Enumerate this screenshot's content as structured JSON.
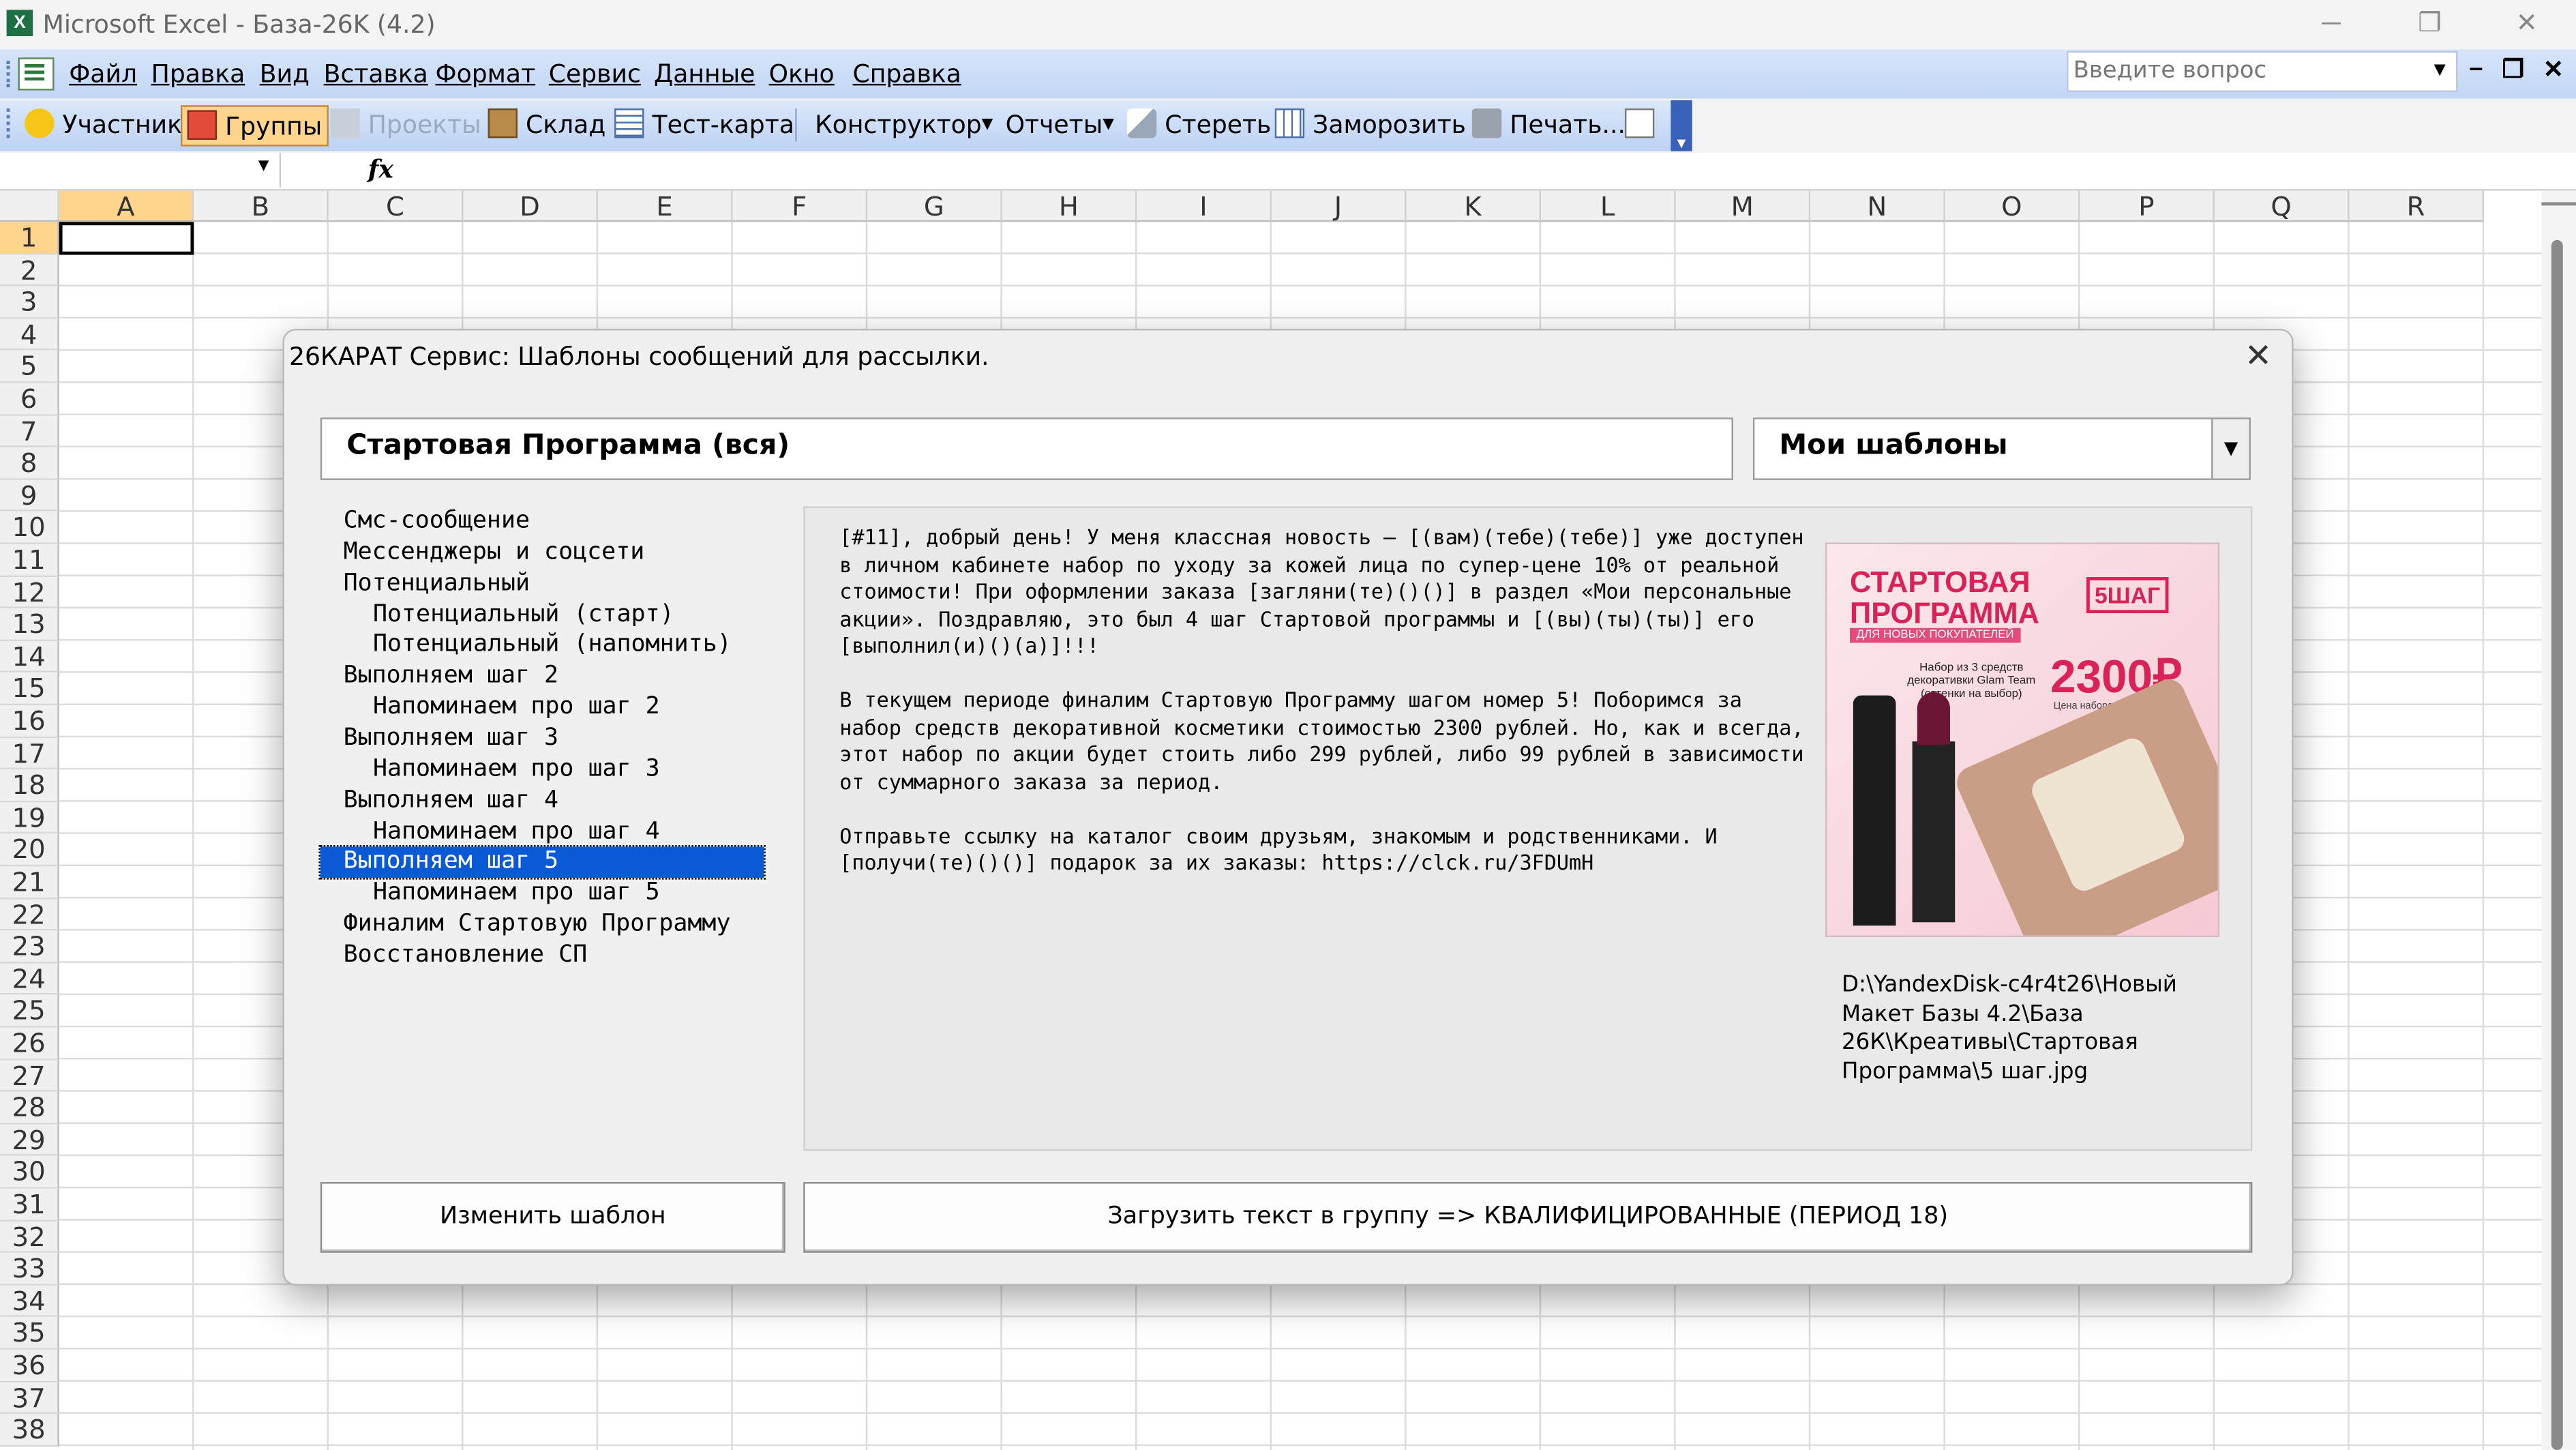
{
  "window": {
    "title": "Microsoft Excel - База-26K (4.2)",
    "app_icon": "excel-icon",
    "controls": [
      "minimize-icon",
      "restore-icon",
      "close-icon"
    ]
  },
  "menubar": {
    "items": [
      "Файл",
      "Правка",
      "Вид",
      "Вставка",
      "Формат",
      "Сервис",
      "Данные",
      "Окно",
      "Справка"
    ],
    "ask_placeholder": "Введите вопрос"
  },
  "toolbar": {
    "buttons": [
      {
        "label": "Участник",
        "icon": "smiley-icon",
        "state": "normal"
      },
      {
        "label": "Группы",
        "icon": "groups-icon",
        "state": "active"
      },
      {
        "label": "Проекты",
        "icon": "projects-icon",
        "state": "disabled"
      },
      {
        "label": "Склад",
        "icon": "warehouse-icon",
        "state": "normal"
      },
      {
        "label": "Тест-карта",
        "icon": "test-card-icon",
        "state": "normal"
      },
      {
        "label": "Конструктор",
        "icon": "",
        "state": "dropdown"
      },
      {
        "label": "Отчеты",
        "icon": "",
        "state": "dropdown"
      },
      {
        "label": "Стереть",
        "icon": "eraser-icon",
        "state": "normal"
      },
      {
        "label": "Заморозить",
        "icon": "freeze-icon",
        "state": "normal"
      },
      {
        "label": "Печать...",
        "icon": "print-icon",
        "state": "normal"
      }
    ]
  },
  "formula_bar": {
    "name_box": "",
    "fx_label": "fx",
    "value": ""
  },
  "sheet": {
    "columns": [
      "A",
      "B",
      "C",
      "D",
      "E",
      "F",
      "G",
      "H",
      "I",
      "J",
      "K",
      "L",
      "M",
      "N",
      "O",
      "P",
      "Q",
      "R"
    ],
    "rows": [
      "1",
      "2",
      "3",
      "4",
      "5",
      "6",
      "7",
      "8",
      "9",
      "10",
      "11",
      "12",
      "13",
      "14",
      "15",
      "16",
      "17",
      "18",
      "19",
      "20",
      "21",
      "22",
      "23",
      "24",
      "25",
      "26",
      "27",
      "28",
      "29",
      "30",
      "31",
      "32",
      "33",
      "34",
      "35",
      "36",
      "37",
      "38"
    ],
    "active_cell": "A1"
  },
  "dialog": {
    "title": "26КАРАТ Сервис: Шаблоны сообщений для рассылки.",
    "template_name": "Стартовая Программа (вся)",
    "template_set": "Мои шаблоны",
    "tree": [
      {
        "label": "Смс-сообщение",
        "level": 0
      },
      {
        "label": "Мессенджеры и соцсети",
        "level": 0
      },
      {
        "label": "Потенциальный",
        "level": 0
      },
      {
        "label": "Потенциальный (старт)",
        "level": 1
      },
      {
        "label": "Потенциальный (напомнить)",
        "level": 1
      },
      {
        "label": "Выполняем шаг 2",
        "level": 0
      },
      {
        "label": "Напоминаем про шаг 2",
        "level": 1
      },
      {
        "label": "Выполняем шаг 3",
        "level": 0
      },
      {
        "label": "Напоминаем про шаг 3",
        "level": 1
      },
      {
        "label": "Выполняем шаг 4",
        "level": 0
      },
      {
        "label": "Напоминаем про шаг 4",
        "level": 1
      },
      {
        "label": "Выполняем шаг 5",
        "level": 0,
        "selected": true
      },
      {
        "label": "Напоминаем про шаг 5",
        "level": 1
      },
      {
        "label": "Финалим Стартовую Программу",
        "level": 0
      },
      {
        "label": "Восстановление СП",
        "level": 0
      }
    ],
    "message": "[#11], добрый день! У меня классная новость — [(вам)(тебе)(тебе)] уже доступен в личном кабинете набор по уходу за кожей лица по супер-цене 10% от реальной стоимости! При оформлении заказа [загляни(те)()()] в раздел «Мои персональные акции». Поздравляю, это был 4 шаг Стартовой программы и [(вы)(ты)(ты)] его [выполнил(и)()(а)]!!!\n\nВ текущем периоде финалим Стартовую Программу шагом номер 5! Поборимся за набор средств декоративной косметики стоимостью 2300 рублей. Но, как и всегда, этот набор по акции будет стоить либо 299 рублей, либо 99 рублей в зависимости от суммарного заказа за период.\n\nОтправьте ссылку на каталог своим друзьям, знакомым и родственниками. И [получи(те)()()] подарок за их заказы: https://clck.ru/3FDUmH",
    "promo": {
      "title": "СТАРТОВАЯ ПРОГРАММА",
      "step": "5ШАГ",
      "subtitle": "ДЛЯ НОВЫХ ПОКУПАТЕЛЕЙ",
      "desc": "Набор из 3 средств декоративки Glam Team (оттенки на выбор)",
      "price": "2300₽",
      "price_note": "Цена набора в каталоге"
    },
    "image_path": "D:\\YandexDisk-c4r4t26\\Новый Макет Базы 4.2\\База 26К\\Креативы\\Стартовая Программа\\5 шаг.jpg",
    "btn_edit": "Изменить шаблон",
    "btn_load": "Загрузить текст в группу => КВАЛИФИЦИРОВАННЫЕ (ПЕРИОД 18)"
  }
}
